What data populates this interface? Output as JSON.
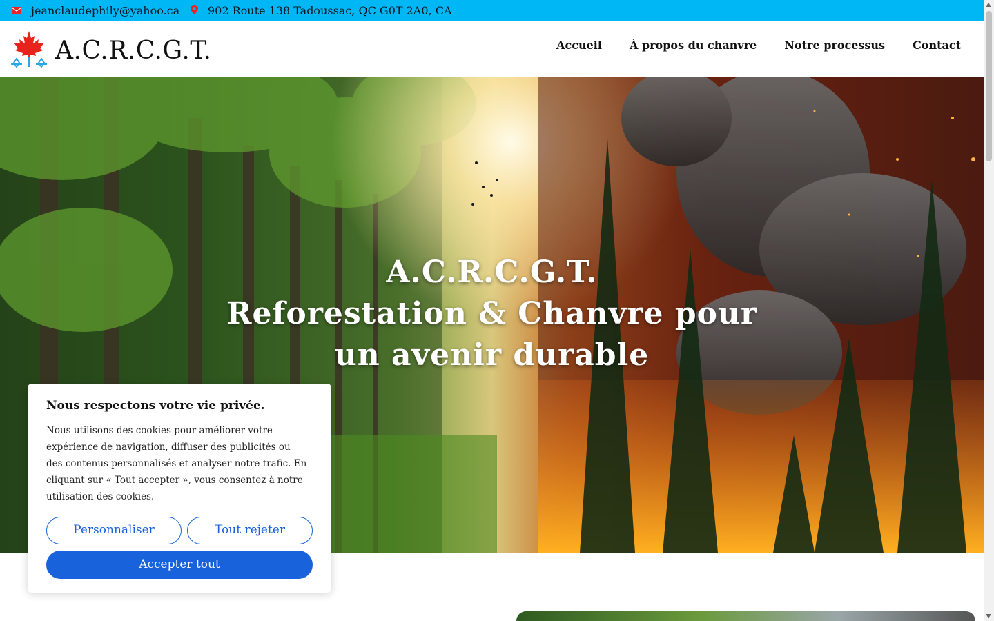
{
  "topbar": {
    "email": "jeanclaudephily@yahoo.ca",
    "address": "902 Route 138 Tadoussac, QC G0T 2A0, CA",
    "icon_color": "#e32626",
    "background": "#00b7f5"
  },
  "header": {
    "logo_text": "A.C.R.C.G.T.",
    "nav": [
      {
        "label": "Accueil"
      },
      {
        "label": "À propos du chanvre"
      },
      {
        "label": "Notre processus"
      },
      {
        "label": "Contact"
      }
    ]
  },
  "hero": {
    "line1": "A.C.R.C.G.T.",
    "line2": "Reforestation & Chanvre pour",
    "line3": "un avenir durable"
  },
  "cookie": {
    "title": "Nous respectons votre vie privée.",
    "body": "Nous utilisons des cookies pour améliorer votre expérience de navigation, diffuser des publicités ou des contenus personnalisés et analyser notre trafic. En cliquant sur « Tout accepter », vous consentez à notre utilisation des cookies.",
    "customize_label": "Personnaliser",
    "reject_label": "Tout rejeter",
    "accept_label": "Accepter tout",
    "accent_color": "#1863dc"
  }
}
